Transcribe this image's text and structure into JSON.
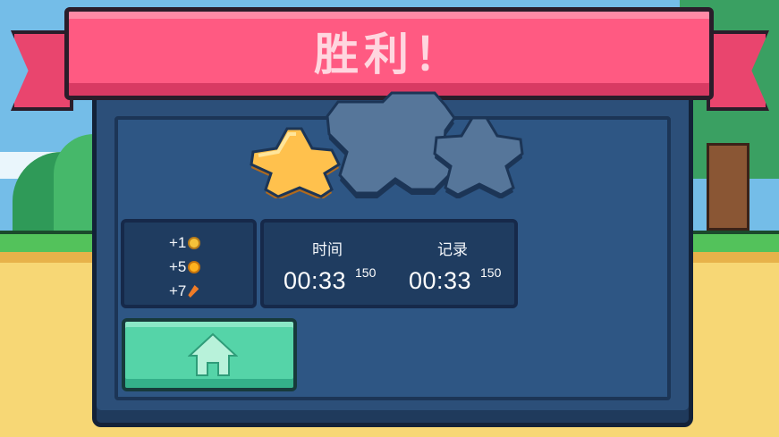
{
  "header": {
    "title": "胜利！"
  },
  "stars": {
    "earned": 1,
    "total": 3
  },
  "rewards": [
    {
      "amount": "+1",
      "icon": "medal-icon"
    },
    {
      "amount": "+5",
      "icon": "coin-icon"
    },
    {
      "amount": "+7",
      "icon": "carrot-icon"
    }
  ],
  "stats": {
    "time_label": "时间",
    "time_value": "00:33",
    "time_ms": "150",
    "record_label": "记录",
    "record_value": "00:33",
    "record_ms": "150"
  },
  "buttons": {
    "home_icon": "home-icon"
  },
  "colors": {
    "ribbon": "#ff5a82",
    "panel": "#2c4f79",
    "star_earned": "#ffc14d",
    "star_empty": "#4f6f93",
    "home_button": "#55d4a8"
  }
}
